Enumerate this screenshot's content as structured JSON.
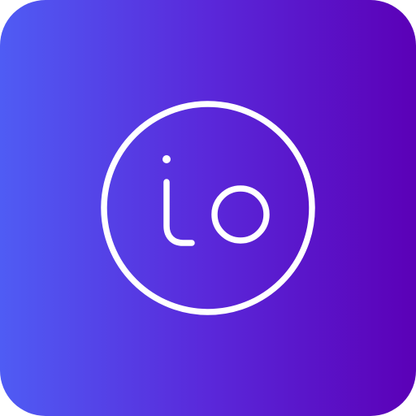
{
  "app_icon": {
    "name": "io",
    "icon_semantic": "io-logo-icon",
    "colors": {
      "gradient_start": "#4f5cf4",
      "gradient_middle": "#5a28da",
      "gradient_end": "#5b00b7",
      "foreground": "#ffffff"
    }
  }
}
